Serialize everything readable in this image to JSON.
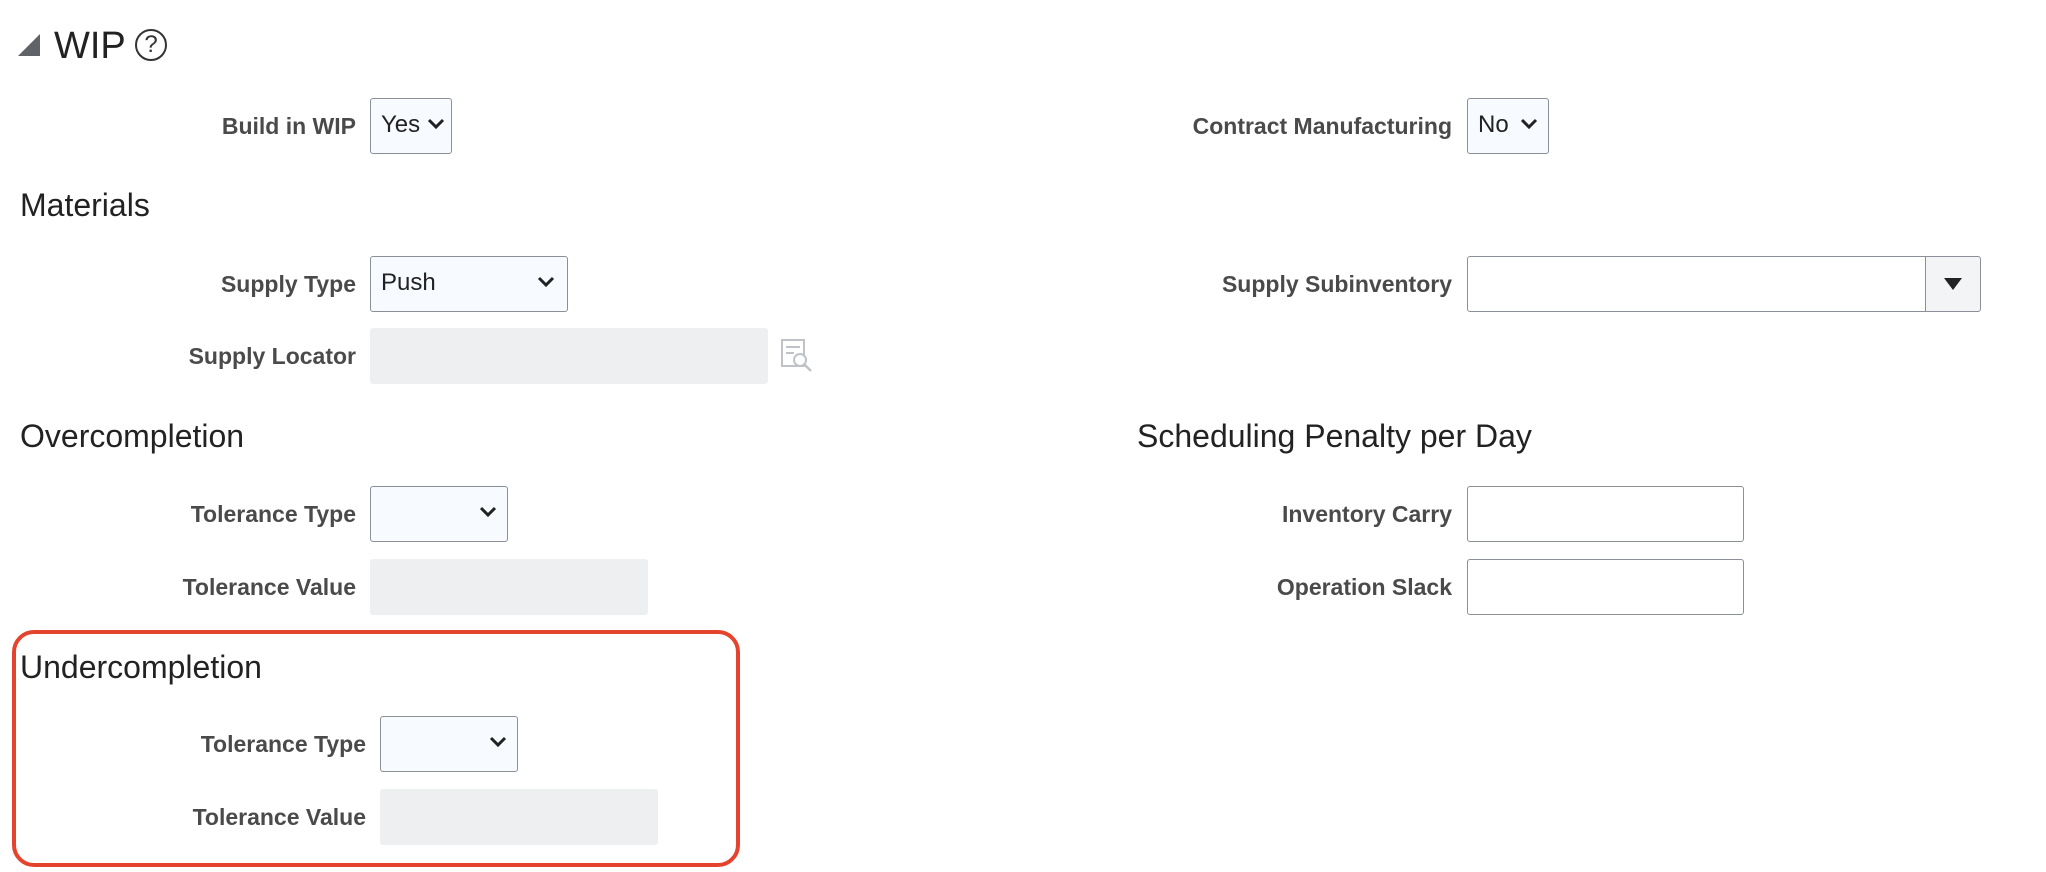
{
  "section": {
    "title": "WIP",
    "help_glyph": "?"
  },
  "wip": {
    "build_in_wip": {
      "label": "Build in WIP",
      "value": "Yes"
    },
    "contract_manufacturing": {
      "label": "Contract Manufacturing",
      "value": "No"
    }
  },
  "materials": {
    "header": "Materials",
    "supply_type": {
      "label": "Supply Type",
      "value": "Push"
    },
    "supply_subinventory": {
      "label": "Supply Subinventory",
      "value": ""
    },
    "supply_locator": {
      "label": "Supply Locator",
      "value": ""
    }
  },
  "overcompletion": {
    "header": "Overcompletion",
    "tolerance_type": {
      "label": "Tolerance Type",
      "value": ""
    },
    "tolerance_value": {
      "label": "Tolerance Value",
      "value": ""
    }
  },
  "scheduling_penalty": {
    "header": "Scheduling Penalty per Day",
    "inventory_carry": {
      "label": "Inventory Carry",
      "value": ""
    },
    "operation_slack": {
      "label": "Operation Slack",
      "value": ""
    }
  },
  "undercompletion": {
    "header": "Undercompletion",
    "tolerance_type": {
      "label": "Tolerance Type",
      "value": ""
    },
    "tolerance_value": {
      "label": "Tolerance Value",
      "value": ""
    }
  },
  "icons": {
    "collapse": "triangle-collapse-icon",
    "help": "help-icon",
    "chevron": "chevron-down-icon",
    "dropdown": "dropdown-arrow-icon",
    "search": "search-icon"
  },
  "colors": {
    "highlight": "#e4432d",
    "field_border": "#8a8f98",
    "disabled_field": "#eeeff1"
  }
}
